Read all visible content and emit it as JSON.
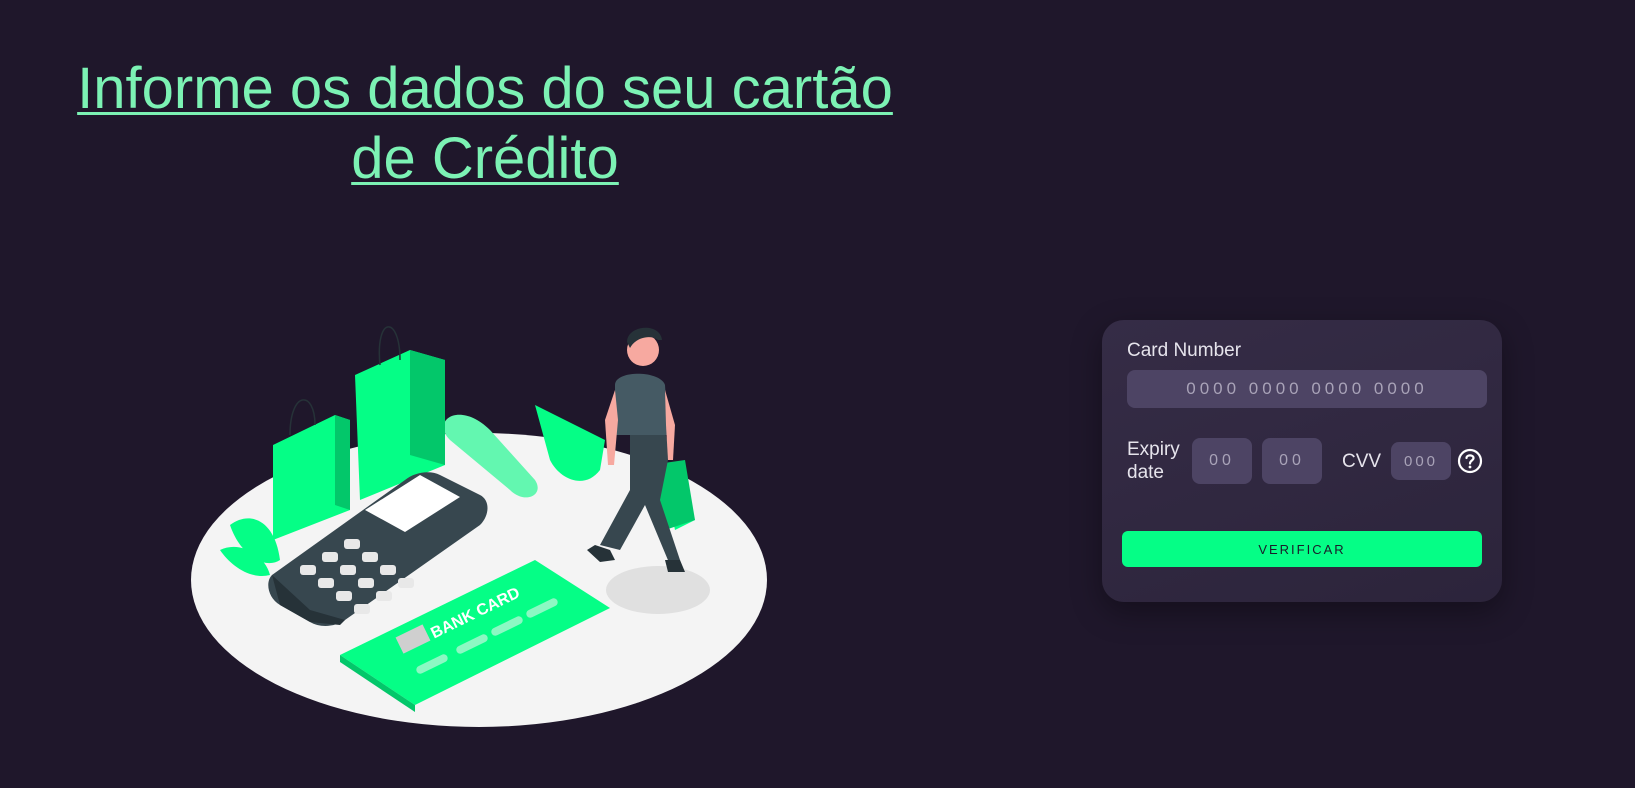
{
  "page": {
    "title": "Informe os dados do seu cartão de Crédito"
  },
  "colors": {
    "background": "#1f172b",
    "accent": "#05fe86",
    "heading": "#7cf2b4",
    "panel": "#2f273f",
    "field": "#4d4464"
  },
  "illustration": {
    "bank_card_text": "BANK CARD"
  },
  "form": {
    "card_number": {
      "label": "Card Number",
      "placeholder": "0000 0000 0000 0000"
    },
    "expiry": {
      "label": "Expiry date",
      "month_placeholder": "00",
      "year_placeholder": "00"
    },
    "cvv": {
      "label": "CVV",
      "placeholder": "000",
      "help_icon": "question-circle-icon"
    },
    "submit_label": "VERIFICAR"
  }
}
